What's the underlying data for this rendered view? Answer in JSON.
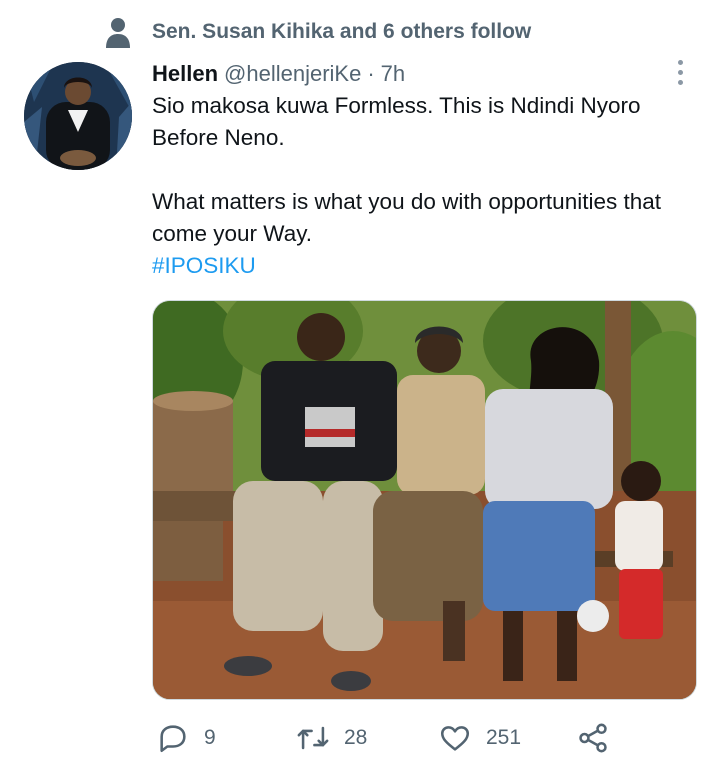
{
  "social_context": {
    "text": "Sen. Susan Kihika and 6 others follow",
    "icon": "person-icon"
  },
  "tweet": {
    "author_name": "Hellen",
    "handle": "@hellenjeriKe",
    "separator": "·",
    "time": "7h",
    "lines": [
      "Sio makosa kuwa Formless. This is Ndindi Nyoro Before Neno.",
      "What matters is what you do with opportunities that come your Way."
    ],
    "hashtag": "#IPOSIKU"
  },
  "actions": {
    "replies": "9",
    "retweets": "28",
    "likes": "251"
  },
  "colors": {
    "link": "#1d9bf0",
    "secondary": "#536471",
    "icon": "#536471"
  }
}
